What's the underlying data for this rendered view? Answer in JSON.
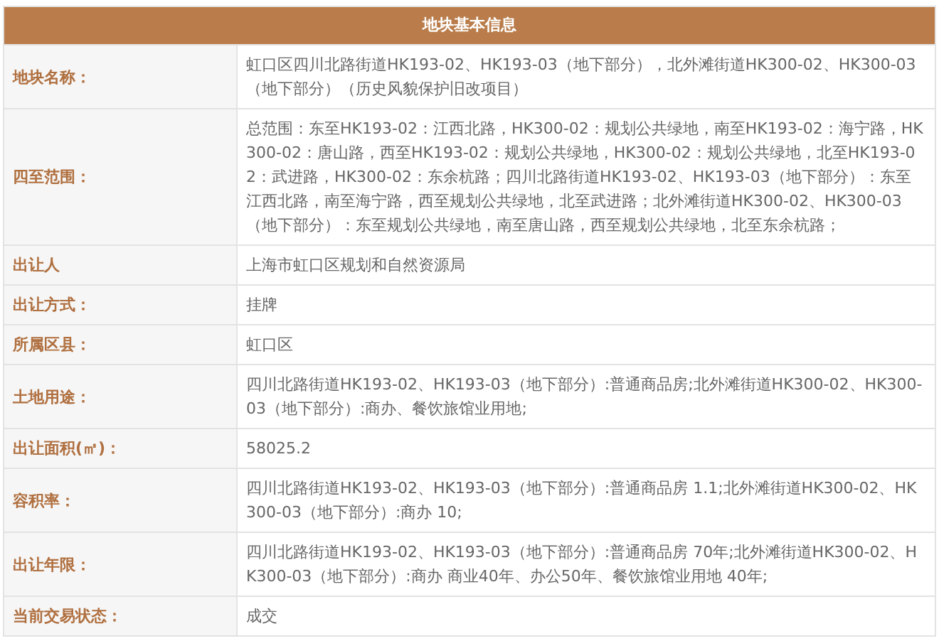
{
  "table": {
    "title": "地块基本信息",
    "rows": [
      {
        "label": "地块名称：",
        "value": "虹口区四川北路街道HK193-02、HK193-03（地下部分），北外滩街道HK300-02、HK300-03（地下部分）（历史风貌保护旧改项目）"
      },
      {
        "label": "四至范围：",
        "value": "总范围：东至HK193-02：江西北路，HK300-02：规划公共绿地，南至HK193-02：海宁路，HK300-02：唐山路，西至HK193-02：规划公共绿地，HK300-02：规划公共绿地，北至HK193-02：武进路，HK300-02：东余杭路；四川北路街道HK193-02、HK193-03（地下部分）：东至江西北路，南至海宁路，西至规划公共绿地，北至武进路；北外滩街道HK300-02、HK300-03（地下部分）：东至规划公共绿地，南至唐山路，西至规划公共绿地，北至东余杭路；"
      },
      {
        "label": "出让人",
        "value": "上海市虹口区规划和自然资源局"
      },
      {
        "label": "出让方式：",
        "value": "挂牌"
      },
      {
        "label": "所属区县：",
        "value": "虹口区"
      },
      {
        "label": "土地用途：",
        "value": "四川北路街道HK193-02、HK193-03（地下部分）:普通商品房;北外滩街道HK300-02、HK300-03（地下部分）:商办、餐饮旅馆业用地;"
      },
      {
        "label": "出让面积(㎡)：",
        "value": "58025.2"
      },
      {
        "label": "容积率：",
        "value": "四川北路街道HK193-02、HK193-03（地下部分）:普通商品房 1.1;北外滩街道HK300-02、HK300-03（地下部分）:商办 10;"
      },
      {
        "label": "出让年限：",
        "value": "四川北路街道HK193-02、HK193-03（地下部分）:普通商品房 70年;北外滩街道HK300-02、HK300-03（地下部分）:商办 商业40年、办公50年、餐饮旅馆业用地 40年;"
      },
      {
        "label": "当前交易状态：",
        "value": "成交"
      }
    ]
  }
}
